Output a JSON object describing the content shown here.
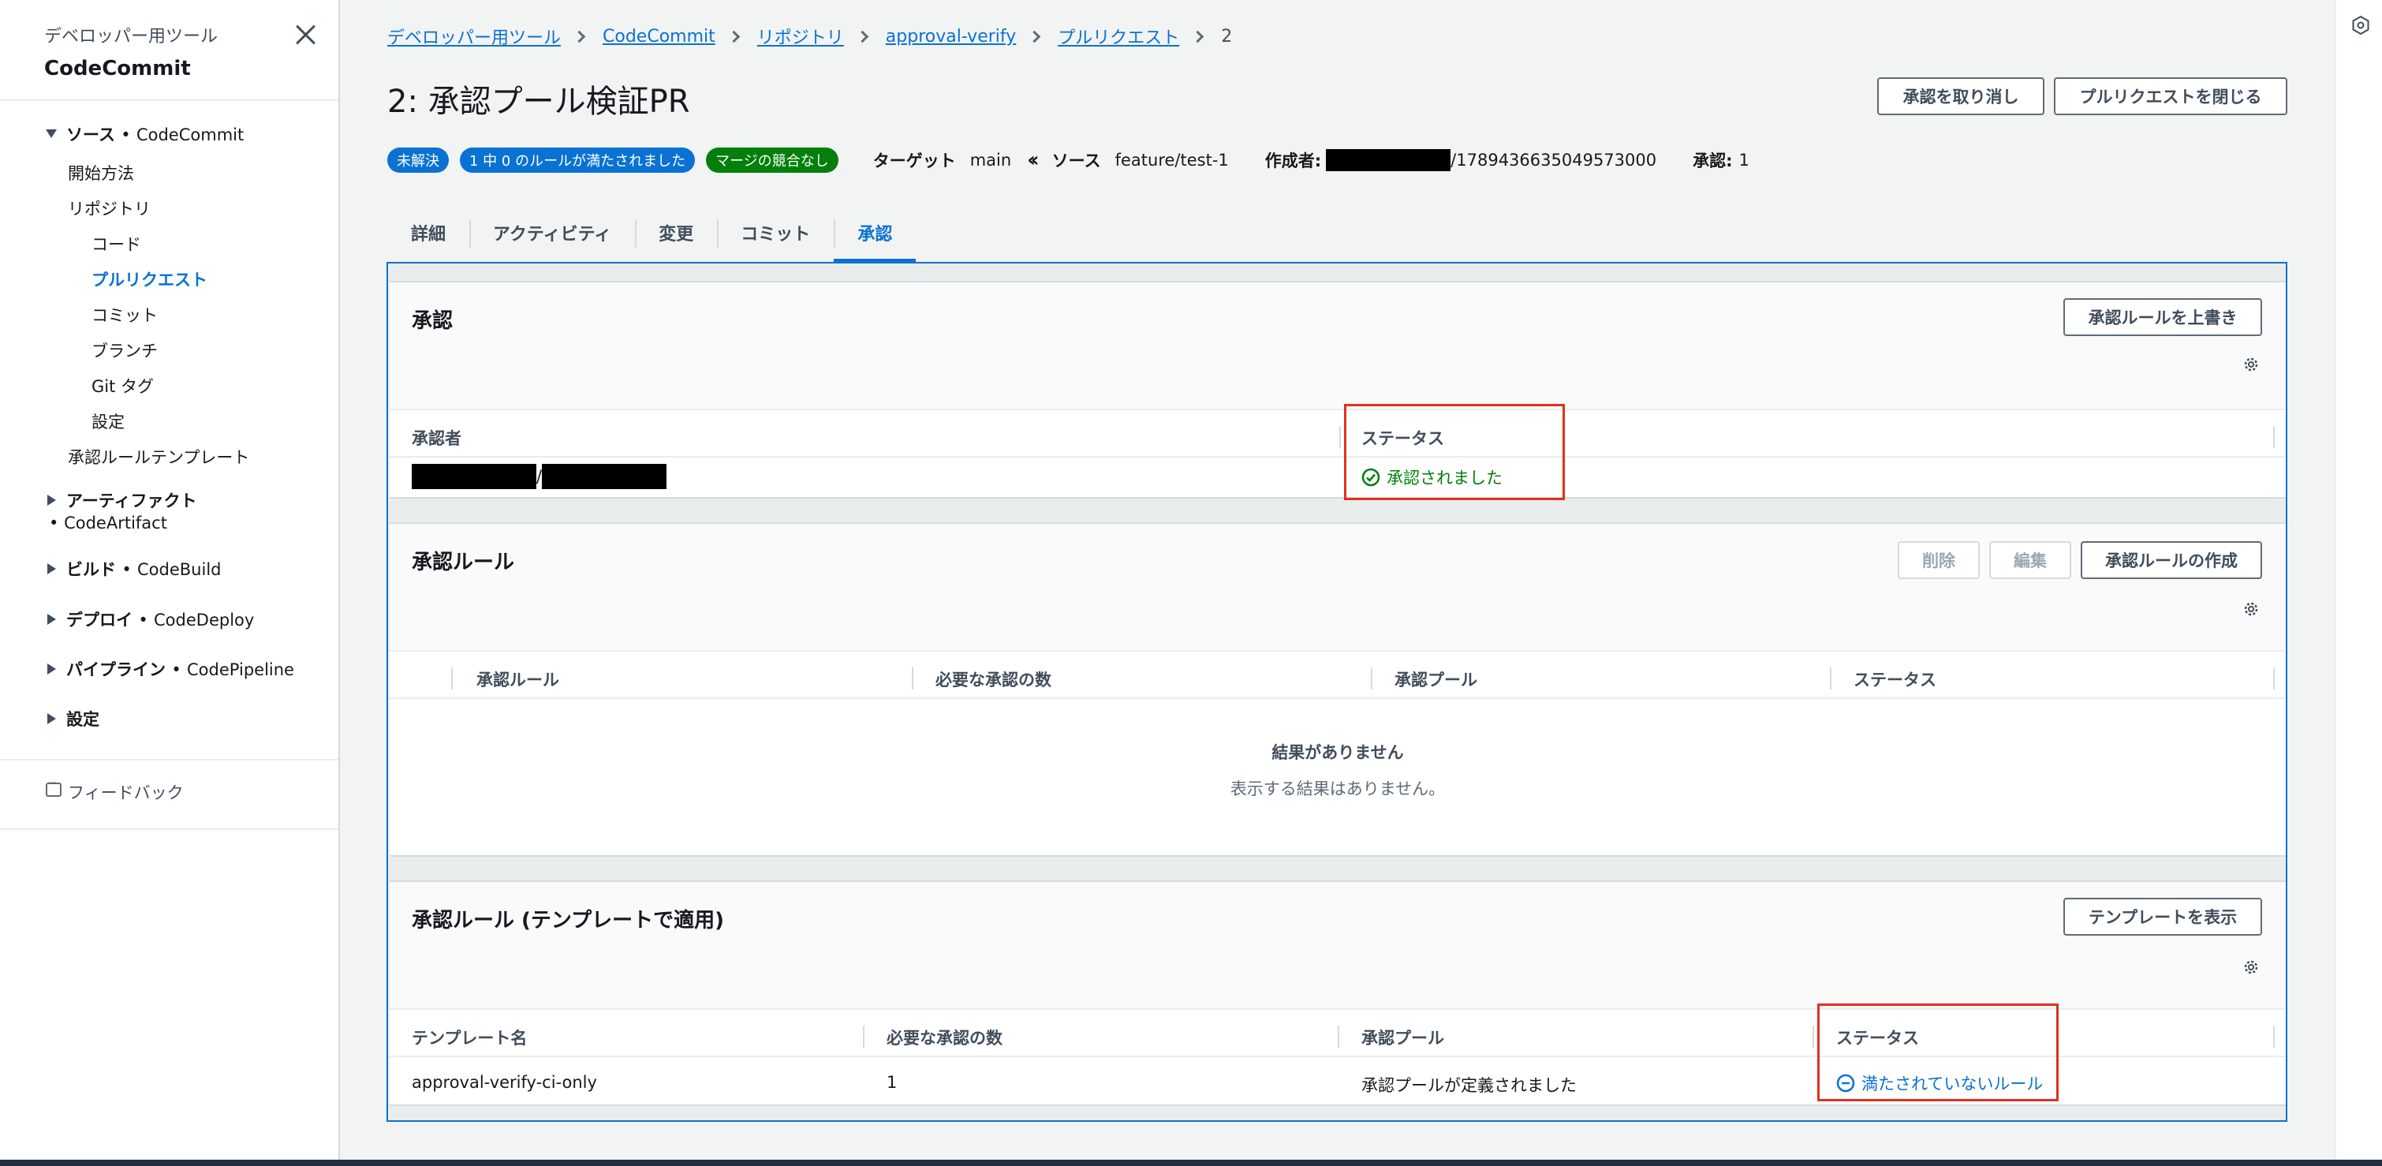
{
  "sidebar": {
    "subtitle": "デベロッパー用ツール",
    "title": "CodeCommit",
    "source_group": {
      "label": "ソース",
      "service": "CodeCommit"
    },
    "items": {
      "getting_started": "開始方法",
      "repositories": "リポジトリ",
      "code": "コード",
      "pull_requests": "プルリクエスト",
      "commits": "コミット",
      "branches": "ブランチ",
      "git_tags": "Git タグ",
      "settings": "設定",
      "approval_rule_templates": "承認ルールテンプレート"
    },
    "artifacts_group": {
      "label": "アーティファクト",
      "service": "CodeArtifact"
    },
    "build_group": {
      "label": "ビルド",
      "service": "CodeBuild"
    },
    "deploy_group": {
      "label": "デプロイ",
      "service": "CodeDeploy"
    },
    "pipeline_group": {
      "label": "パイプライン",
      "service": "CodePipeline"
    },
    "settings_group": {
      "label": "設定"
    },
    "feedback": "フィードバック",
    "bullet": "•"
  },
  "breadcrumb": {
    "items": [
      "デベロッパー用ツール",
      "CodeCommit",
      "リポジトリ",
      "approval-verify",
      "プルリクエスト"
    ],
    "current": "2"
  },
  "page": {
    "title": "2: 承認プール検証PR",
    "revoke_button": "承認を取り消し",
    "close_button": "プルリクエストを閉じる"
  },
  "meta": {
    "badge_status": "未解決",
    "badge_rules": "1 中 0 のルールが満たされました",
    "badge_merge": "マージの競合なし",
    "target_label": "ターゲット",
    "target_value": "main",
    "source_label": "ソース",
    "source_value": "feature/test-1",
    "author_label": "作成者:",
    "author_suffix": "/1789436635049573000",
    "approvals_label": "承認:",
    "approvals_value": "1",
    "badge_blue_color": "#0972d3",
    "badge_green_color": "#037f0c"
  },
  "tabs": [
    "詳細",
    "アクティビティ",
    "変更",
    "コミット",
    "承認"
  ],
  "approvals_section": {
    "title": "承認",
    "override_button": "承認ルールを上書き",
    "columns": [
      "承認者",
      "ステータス"
    ],
    "row": {
      "separator": "/",
      "status": "承認されました"
    }
  },
  "rules_section": {
    "title": "承認ルール",
    "delete_button": "削除",
    "edit_button": "編集",
    "create_button": "承認ルールの作成",
    "columns": [
      "承認ルール",
      "必要な承認の数",
      "承認プール",
      "ステータス"
    ],
    "empty_title": "結果がありません",
    "empty_sub": "表示する結果はありません。"
  },
  "template_section": {
    "title": "承認ルール (テンプレートで適用)",
    "view_button": "テンプレートを表示",
    "columns": [
      "テンプレート名",
      "必要な承認の数",
      "承認プール",
      "ステータス"
    ],
    "row": {
      "name": "approval-verify-ci-only",
      "count": "1",
      "pool": "承認プールが定義されました",
      "status": "満たされていないルール"
    }
  },
  "colors": {
    "accent": "#0972d3",
    "success": "#037f0c",
    "highlight": "#e0301e"
  }
}
